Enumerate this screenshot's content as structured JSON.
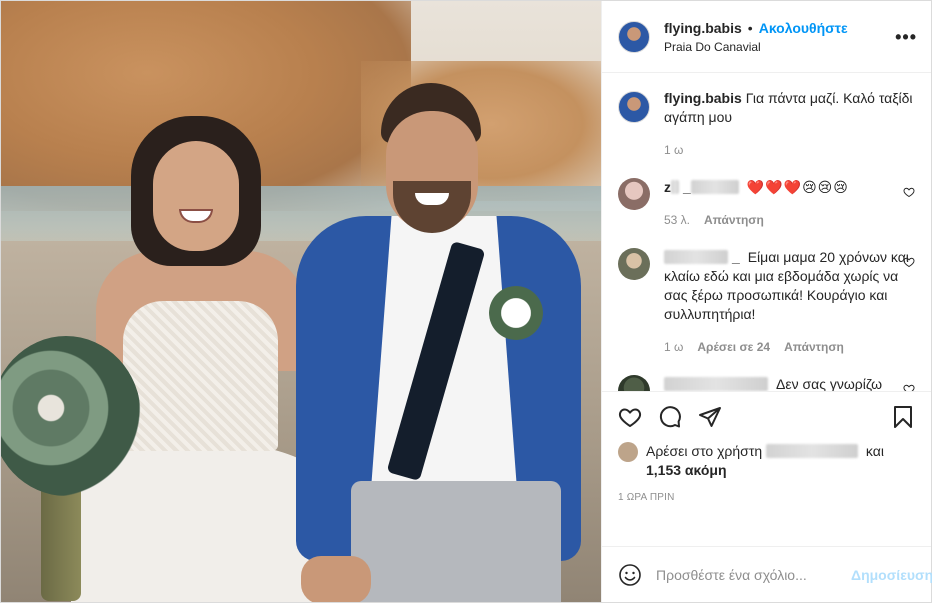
{
  "post": {
    "username": "flying.babis",
    "follow_label": "Ακολουθήστε",
    "separator": "•",
    "location": "Praia Do Canavial",
    "more_label": "•••"
  },
  "caption": {
    "username": "flying.babis",
    "text": "Για πάντα μαζί. Καλό ταξίδι αγάπη μου",
    "time": "1 ω"
  },
  "comments": [
    {
      "username_visible": "z",
      "username_tail": "_",
      "text": "❤️❤️❤️😢😢😢",
      "time": "53 λ.",
      "reply_label": "Απάντηση",
      "likes": ""
    },
    {
      "username_visible": "",
      "username_tail": "_",
      "text": "Είμαι μαμα 20 χρόνων και κλαίω εδώ και μια εβδομάδα χωρίς να σας ξέρω προσωπικά! Κουράγιο και συλλυπητήρια!",
      "time": "1 ω",
      "likes": "Αρέσει σε 24",
      "reply_label": "Απάντηση"
    },
    {
      "username_visible": "",
      "username_tail": "",
      "text": "Δεν σας γνωρίζω προσωπικά αλλά από",
      "time": "",
      "likes": "",
      "reply_label": ""
    }
  ],
  "likes_bar": {
    "prefix": "Αρέσει στο χρήστη",
    "conjunction": "και",
    "count": "1,153 ακόμη"
  },
  "timestamp": "1 ΩΡΑ ΠΡΙΝ",
  "add_comment": {
    "placeholder": "Προσθέστε ένα σχόλιο...",
    "post_label": "Δημοσίευση"
  },
  "icons": {
    "like": "heart-icon",
    "comment": "comment-icon",
    "share": "share-icon",
    "save": "bookmark-icon",
    "emoji": "emoji-icon",
    "more": "more-icon"
  },
  "colors": {
    "link": "#0095f6",
    "post_disabled": "#b2dffc",
    "secondary_text": "#8e8e8e"
  }
}
